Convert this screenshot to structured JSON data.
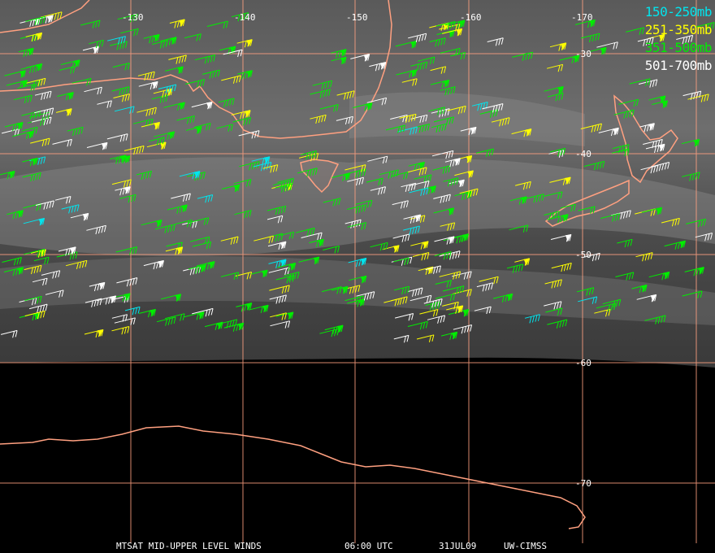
{
  "map": {
    "legend": [
      {
        "label": "150-250mb",
        "color": "#00e5ee"
      },
      {
        "label": "251-350mb",
        "color": "#ffff00"
      },
      {
        "label": "351-500mb",
        "color": "#00ee00"
      },
      {
        "label": "501-700mb",
        "color": "#ffffff"
      }
    ],
    "longitude_labels": [
      "-130",
      "-140",
      "-150",
      "-160",
      "-170"
    ],
    "latitude_labels": [
      "-30",
      "-40",
      "-50",
      "-60",
      "-70"
    ],
    "footer": {
      "product": "MTSAT MID-UPPER LEVEL WINDS",
      "time": "06:00 UTC",
      "date": "31JUL09",
      "source": "UW-CIMSS"
    },
    "colors": {
      "grid": "#ffa080",
      "coast": "#ffa080",
      "background": "#000000"
    }
  }
}
